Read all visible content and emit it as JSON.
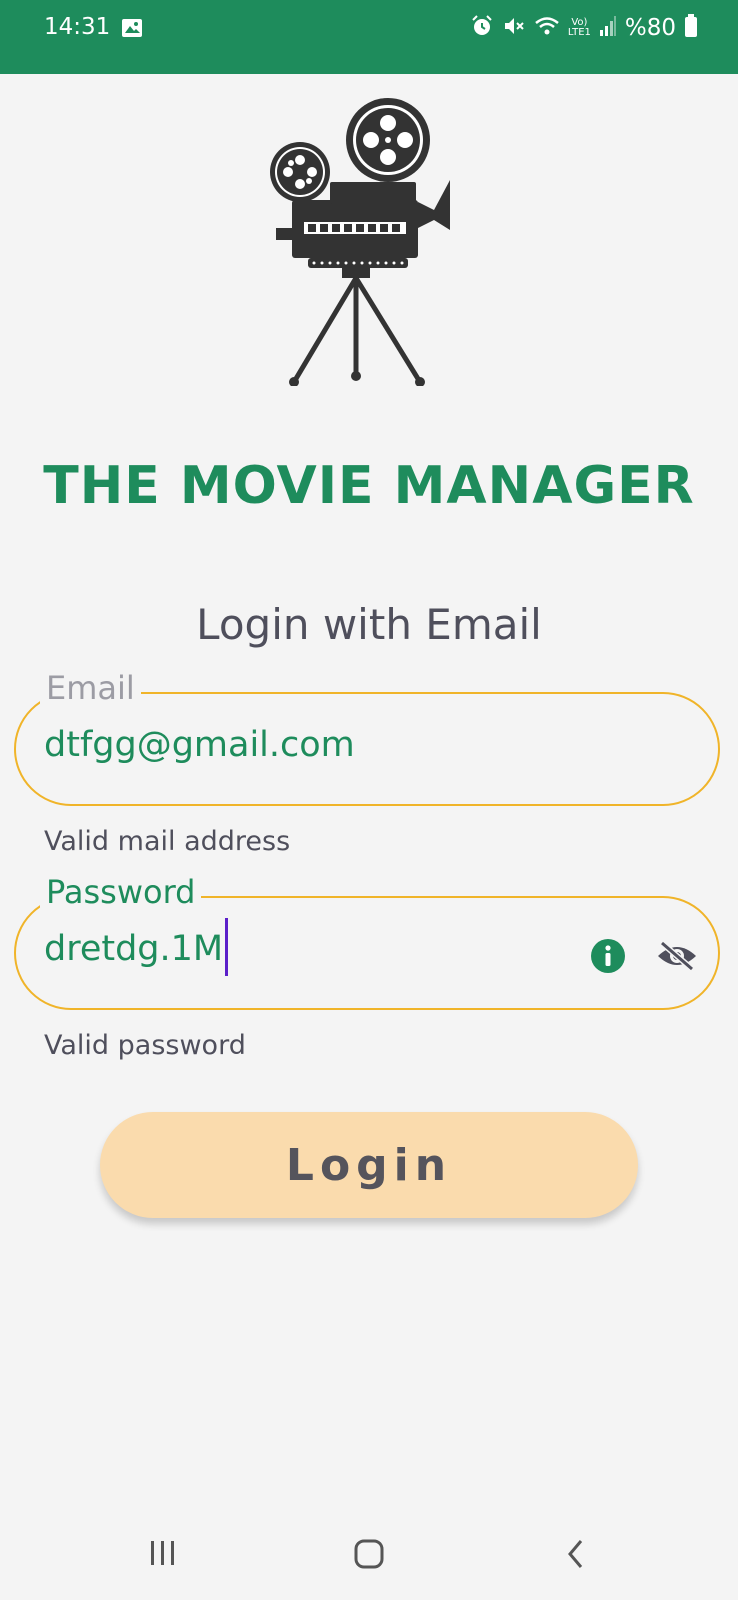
{
  "status_bar": {
    "time": "14:31",
    "battery": "%80",
    "network": "LTE1",
    "icons": [
      "gallery-icon",
      "alarm-icon",
      "mute-icon",
      "wifi-icon",
      "volte-icon",
      "signal-icon",
      "battery-icon"
    ],
    "background": "#1e8c5c"
  },
  "app": {
    "title": "THE MOVIE MANAGER",
    "logo_icon": "movie-camera-icon",
    "subtitle": "Login with Email"
  },
  "form": {
    "email": {
      "label": "Email",
      "value": "dtfgg@gmail.com",
      "helper": "Valid mail address"
    },
    "password": {
      "label": "Password",
      "value": "dretdg.1M",
      "helper": "Valid password",
      "info_icon": "info-icon",
      "visibility_icon": "eye-off-icon"
    },
    "login_label": "Login"
  },
  "nav": {
    "recents_icon": "recents-icon",
    "home_icon": "home-icon",
    "back_icon": "back-icon"
  },
  "colors": {
    "accent": "#1e8c5c",
    "field_border": "#f0b429",
    "button": "#fadbad",
    "cursor": "#5b1fc9"
  }
}
